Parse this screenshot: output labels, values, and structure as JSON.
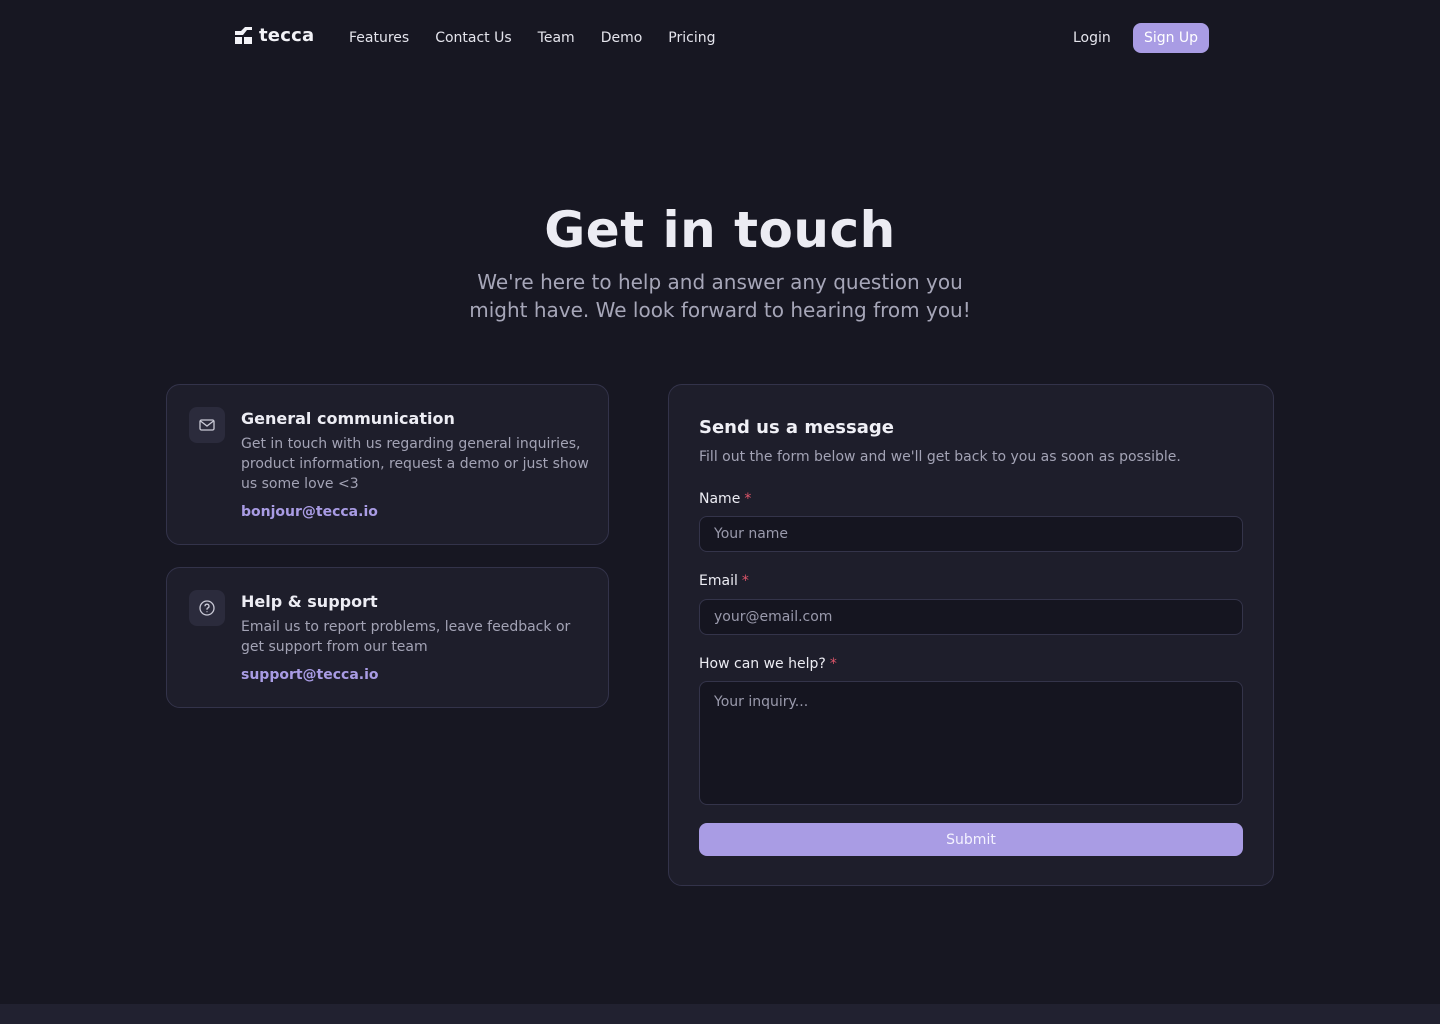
{
  "brand": {
    "name": "tecca",
    "logo_icon": "tecca-logo-icon"
  },
  "nav": {
    "links": [
      "Features",
      "Contact Us",
      "Team",
      "Demo",
      "Pricing"
    ],
    "login": "Login",
    "signup": "Sign Up"
  },
  "hero": {
    "title": "Get in touch",
    "subtitle": "We're here to help and answer any question you might have. We look forward to hearing from you!"
  },
  "contact_cards": [
    {
      "icon": "mail-icon",
      "title": "General communication",
      "description": "Get in touch with us regarding general inquiries, product information, request a demo or just show us some love <3",
      "email": "bonjour@tecca.io"
    },
    {
      "icon": "help-circle-icon",
      "title": "Help & support",
      "description": "Email us to report problems, leave feedback or get support from our team",
      "email": "support@tecca.io"
    }
  ],
  "form": {
    "title": "Send us a message",
    "subtitle": "Fill out the form below and we'll get back to you as soon as possible.",
    "required_mark": "*",
    "fields": {
      "name": {
        "label": "Name",
        "placeholder": "Your name",
        "value": ""
      },
      "email": {
        "label": "Email",
        "placeholder": "your@email.com",
        "value": ""
      },
      "help": {
        "label": "How can we help?",
        "placeholder": "Your inquiry...",
        "value": ""
      }
    },
    "submit": "Submit"
  },
  "colors": {
    "background": "#171722",
    "card": "#1e1e2b",
    "accent": "#a99ce4",
    "required": "#e0566a"
  }
}
